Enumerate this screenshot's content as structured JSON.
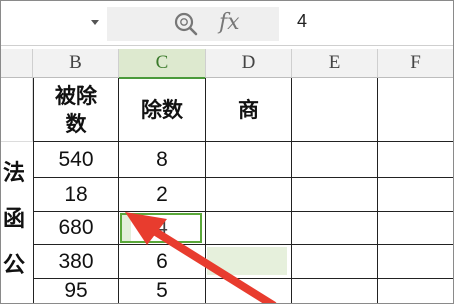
{
  "formula_bar": {
    "fx_label": "fx",
    "value": "4"
  },
  "columns": [
    "B",
    "C",
    "D",
    "E",
    "F"
  ],
  "active_column": "C",
  "table": {
    "headers": [
      "被除\n数",
      "除数",
      "商"
    ],
    "rows": [
      {
        "dividend": "540",
        "divisor": "8",
        "quotient": ""
      },
      {
        "dividend": "18",
        "divisor": "2",
        "quotient": ""
      },
      {
        "dividend": "680",
        "divisor": "4",
        "quotient": ""
      },
      {
        "dividend": "380",
        "divisor": "6",
        "quotient": ""
      },
      {
        "dividend": "95",
        "divisor": "5",
        "quotient": ""
      }
    ]
  },
  "side_text": [
    "法",
    "函",
    "公"
  ],
  "colors": {
    "selection": "#5aa83a",
    "arrow": "#e83c2e",
    "active_header": "#dde9cf"
  }
}
